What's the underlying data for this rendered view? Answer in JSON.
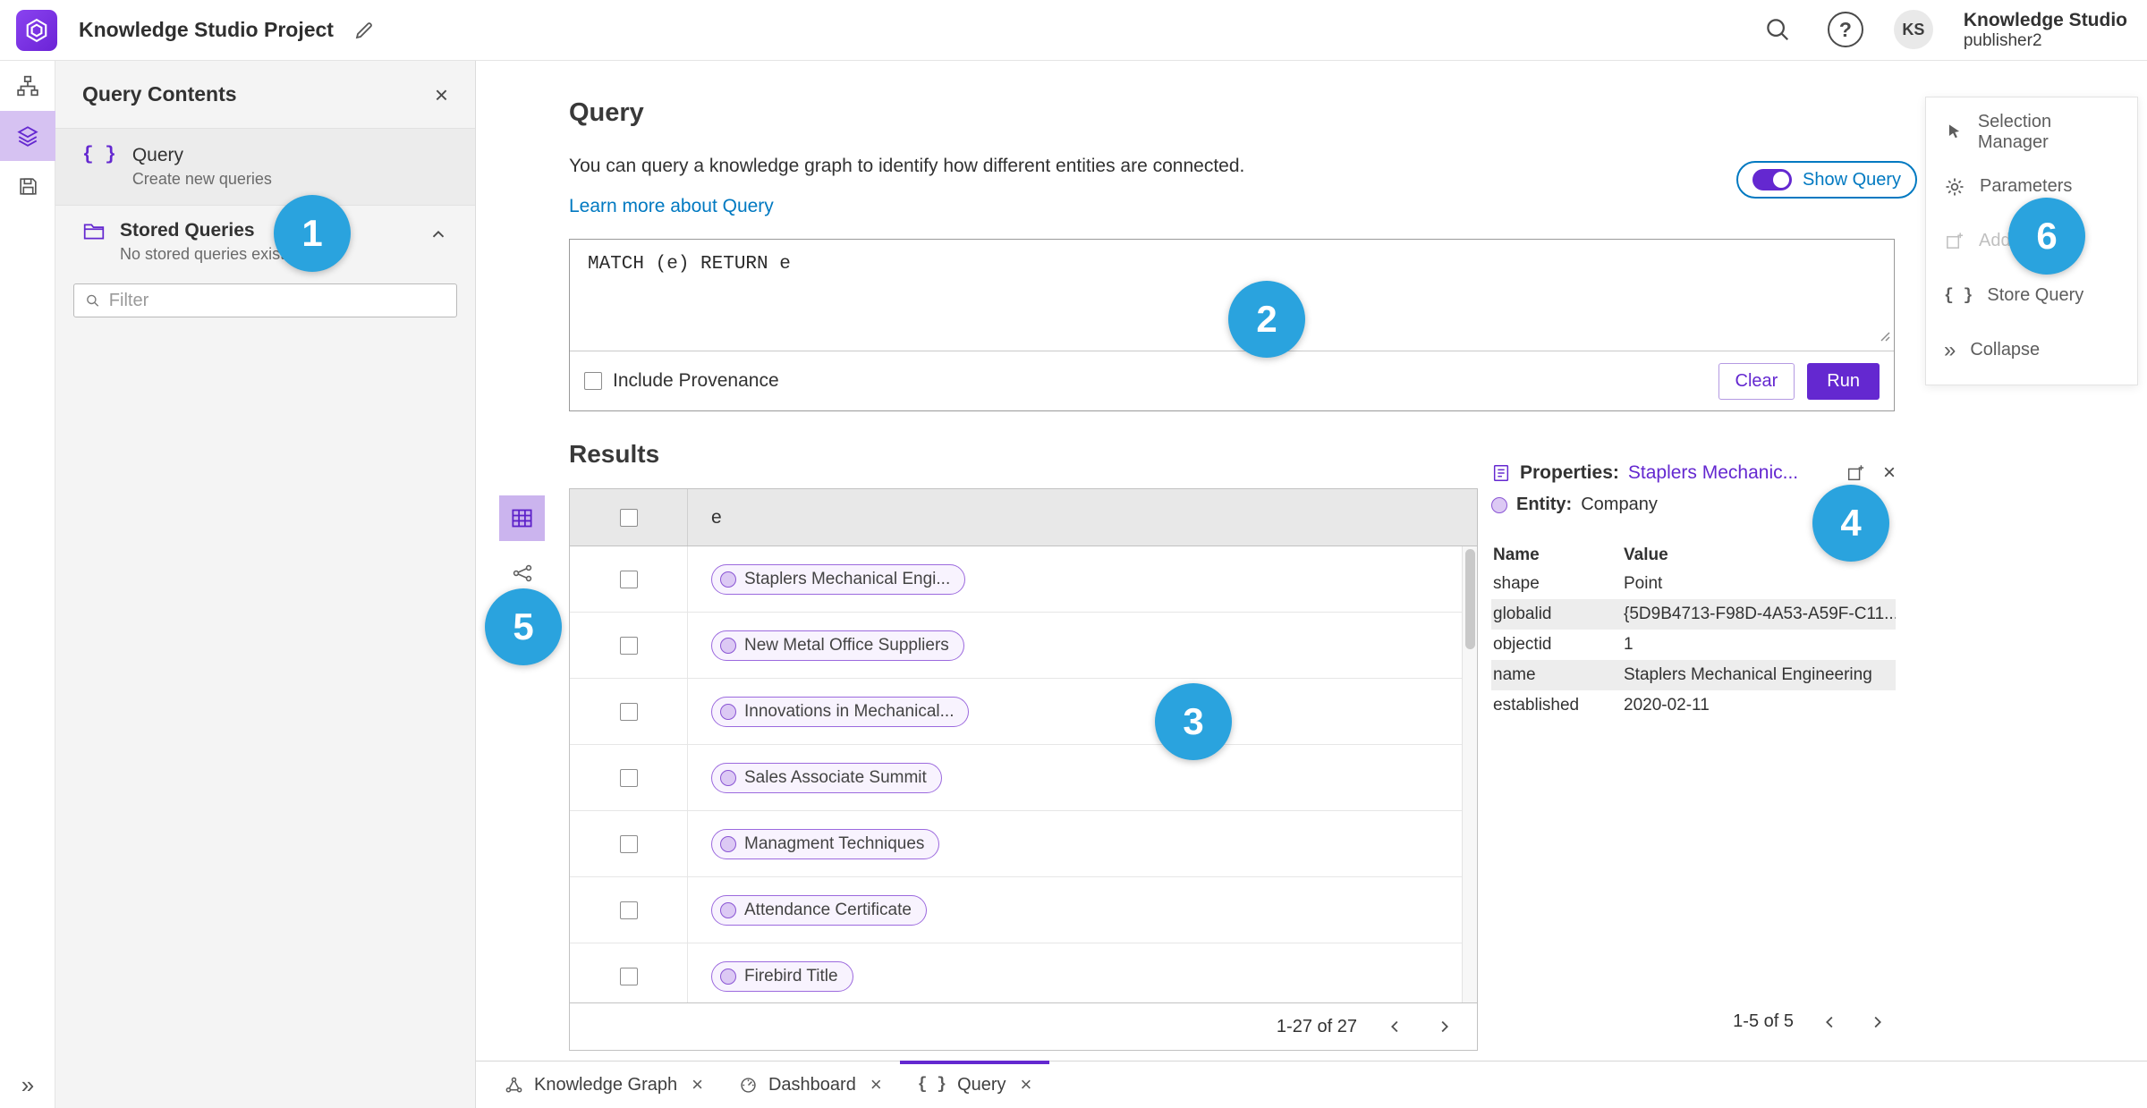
{
  "topbar": {
    "title": "Knowledge Studio Project",
    "user_name": "Knowledge Studio",
    "user_sub": "publisher2",
    "avatar": "KS",
    "help_glyph": "?"
  },
  "left_panel": {
    "title": "Query Contents",
    "query_item": {
      "label": "Query",
      "sub": "Create new queries"
    },
    "stored": {
      "label": "Stored Queries",
      "sub": "No stored queries exist"
    },
    "filter_placeholder": "Filter"
  },
  "query": {
    "title": "Query",
    "description": "You can query a knowledge graph to identify how different entities are connected.",
    "learn_link": "Learn more about Query",
    "show_query": "Show Query",
    "text": "MATCH (e) RETURN e",
    "include_provenance": "Include Provenance",
    "clear": "Clear",
    "run": "Run"
  },
  "results": {
    "title": "Results",
    "column": "e",
    "rows": [
      "Staplers Mechanical Engi...",
      "New Metal Office Suppliers",
      "Innovations in Mechanical...",
      "Sales Associate Summit",
      "Managment Techniques",
      "Attendance Certificate",
      "Firebird Title"
    ],
    "pagination": "1-27 of 27"
  },
  "props": {
    "title_label": "Properties:",
    "title_target": "Staplers Mechanic...",
    "entity_label": "Entity:",
    "entity_value": "Company",
    "col_name": "Name",
    "col_value": "Value",
    "rows": [
      {
        "name": "shape",
        "value": "Point"
      },
      {
        "name": "globalid",
        "value": "{5D9B4713-F98D-4A53-A59F-C11..."
      },
      {
        "name": "objectid",
        "value": "1"
      },
      {
        "name": "name",
        "value": "Staplers Mechanical Engineering"
      },
      {
        "name": "established",
        "value": "2020-02-11"
      }
    ],
    "pagination": "1-5 of 5"
  },
  "side_menu": {
    "items": [
      {
        "label": "Selection Manager"
      },
      {
        "label": "Parameters"
      },
      {
        "label": "Add To Map"
      },
      {
        "label": "Store Query"
      },
      {
        "label": "Collapse"
      }
    ]
  },
  "tabs": [
    {
      "label": "Knowledge Graph"
    },
    {
      "label": "Dashboard"
    },
    {
      "label": "Query"
    }
  ],
  "callouts": [
    "1",
    "2",
    "3",
    "4",
    "5",
    "6"
  ],
  "colors": {
    "purple": "#6428d0",
    "purpleSoft": "#d6c2f2",
    "pillBg": "#f8f3fe",
    "pillBorder": "#9c6ade",
    "blue": "#0079c1",
    "badge": "#2aa3de",
    "text": "#323232",
    "textSub": "#6a6a6a",
    "panel": "#f4f4f4",
    "border": "#dcdcdc",
    "tableBorder": "#c2c2c2",
    "headerBg": "#e8e8e8"
  }
}
